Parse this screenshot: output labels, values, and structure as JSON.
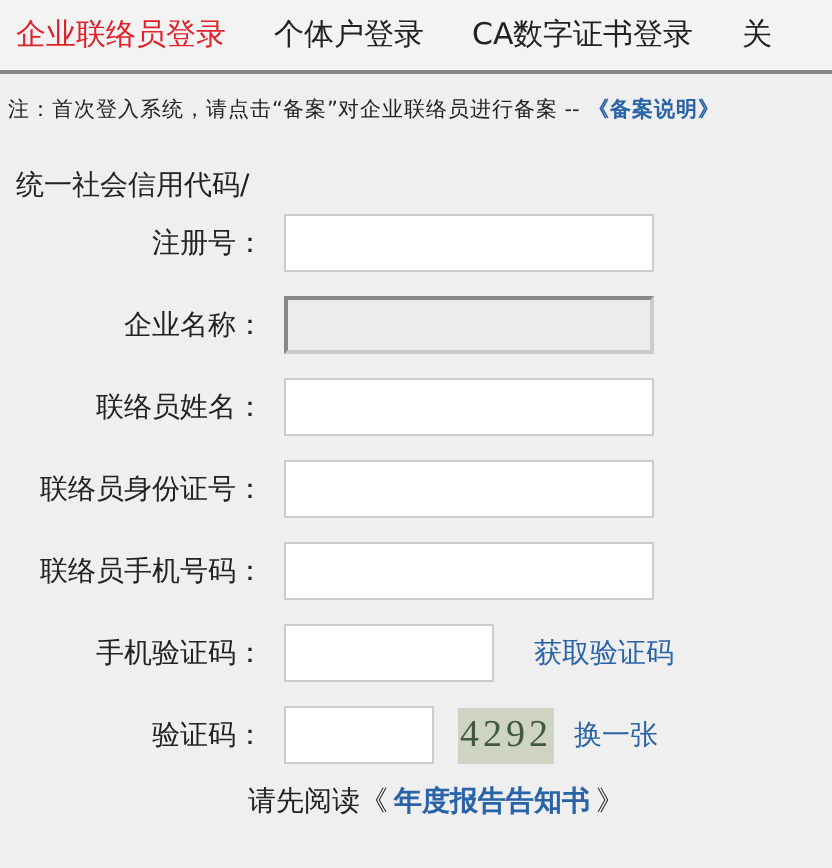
{
  "tabs": [
    {
      "label": "企业联络员登录",
      "selected": true
    },
    {
      "label": "个体户登录",
      "selected": false
    },
    {
      "label": "CA数字证书登录",
      "selected": false
    },
    {
      "label": "关",
      "selected": false
    }
  ],
  "note": {
    "text": "注：首次登入系统，请点击“备案”对企业联络员进行备案 --",
    "link": "《备案说明》"
  },
  "form_heading": "统一社会信用代码/",
  "fields": [
    {
      "kind": "text",
      "label": "注册号：",
      "disabled": false
    },
    {
      "kind": "text",
      "label": "企业名称：",
      "disabled": true
    },
    {
      "kind": "text",
      "label": "联络员姓名：",
      "disabled": false
    },
    {
      "kind": "text",
      "label": "联络员身份证号：",
      "disabled": false
    },
    {
      "kind": "text",
      "label": "联络员手机号码：",
      "disabled": false
    },
    {
      "kind": "sms",
      "label": "手机验证码：",
      "disabled": false,
      "link": "获取验证码"
    },
    {
      "kind": "captcha",
      "label": "验证码：",
      "disabled": false,
      "captcha": "4292",
      "link": "换一张"
    }
  ],
  "notice": {
    "prefix": "请先阅读《",
    "link": "年度报告告知书",
    "suffix": "》"
  }
}
